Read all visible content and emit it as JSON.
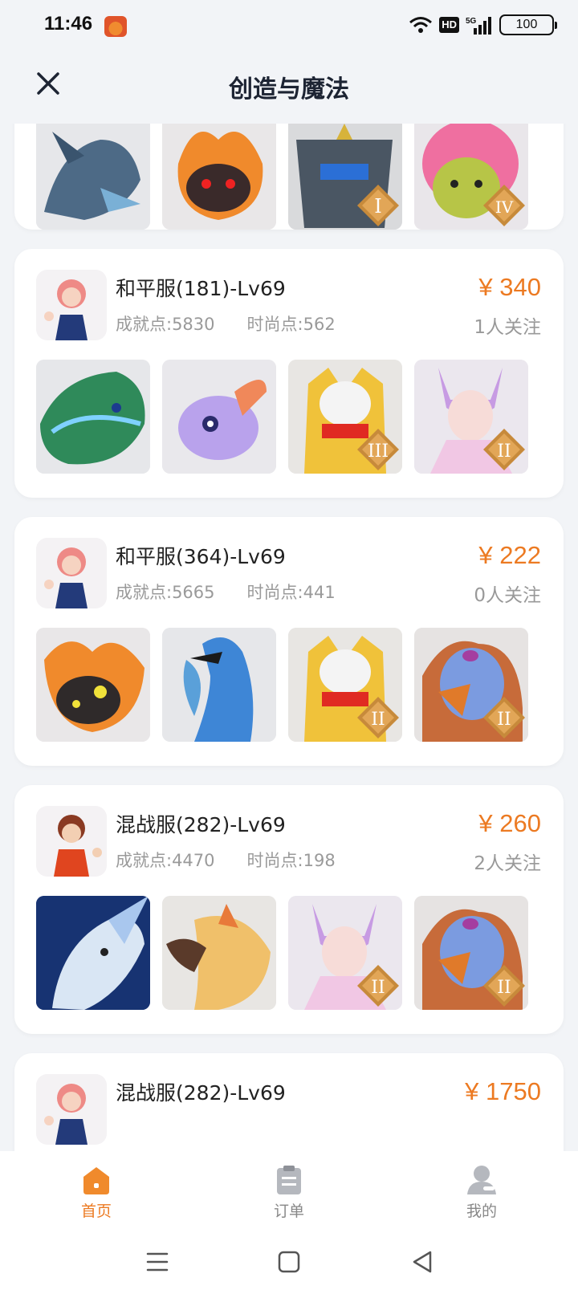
{
  "status": {
    "time": "11:46",
    "hd": "HD",
    "network": "5G",
    "battery": "100"
  },
  "header": {
    "title": "创造与魔法"
  },
  "listings": [
    {
      "title": "和平服(181)-Lv69",
      "achievement": "成就点:5830",
      "fashion": "时尚点:562",
      "price": "¥ 340",
      "followers": "1人关注",
      "thumbs": [
        {
          "kind": "dragon-green",
          "rank": ""
        },
        {
          "kind": "pet-purple",
          "rank": ""
        },
        {
          "kind": "helmet-gold",
          "rank": "III"
        },
        {
          "kind": "lady-pink",
          "rank": "II"
        }
      ]
    },
    {
      "title": "和平服(364)-Lv69",
      "achievement": "成就点:5665",
      "fashion": "时尚点:441",
      "price": "¥ 222",
      "followers": "0人关注",
      "thumbs": [
        {
          "kind": "fire-beast",
          "rank": ""
        },
        {
          "kind": "blue-bird",
          "rank": ""
        },
        {
          "kind": "helmet-gold",
          "rank": "II"
        },
        {
          "kind": "griffin",
          "rank": "II"
        }
      ]
    },
    {
      "title": "混战服(282)-Lv69",
      "achievement": "成就点:4470",
      "fashion": "时尚点:198",
      "price": "¥ 260",
      "followers": "2人关注",
      "thumbs": [
        {
          "kind": "blue-wolf",
          "rank": ""
        },
        {
          "kind": "gold-bird",
          "rank": ""
        },
        {
          "kind": "lady-pink",
          "rank": "II"
        },
        {
          "kind": "griffin",
          "rank": "II"
        }
      ]
    },
    {
      "title": "混战服(282)-Lv69",
      "price": "¥ 1750"
    }
  ],
  "top_card_thumbs": [
    {
      "kind": "blue-dragon",
      "rank": ""
    },
    {
      "kind": "fire-beast",
      "rank": ""
    },
    {
      "kind": "robot",
      "rank": "I"
    },
    {
      "kind": "pink-cat",
      "rank": "IV"
    }
  ],
  "nav": {
    "home": "首页",
    "orders": "订单",
    "mine": "我的"
  },
  "colors": {
    "accent": "#ec7a22",
    "background": "#f2f4f7"
  }
}
